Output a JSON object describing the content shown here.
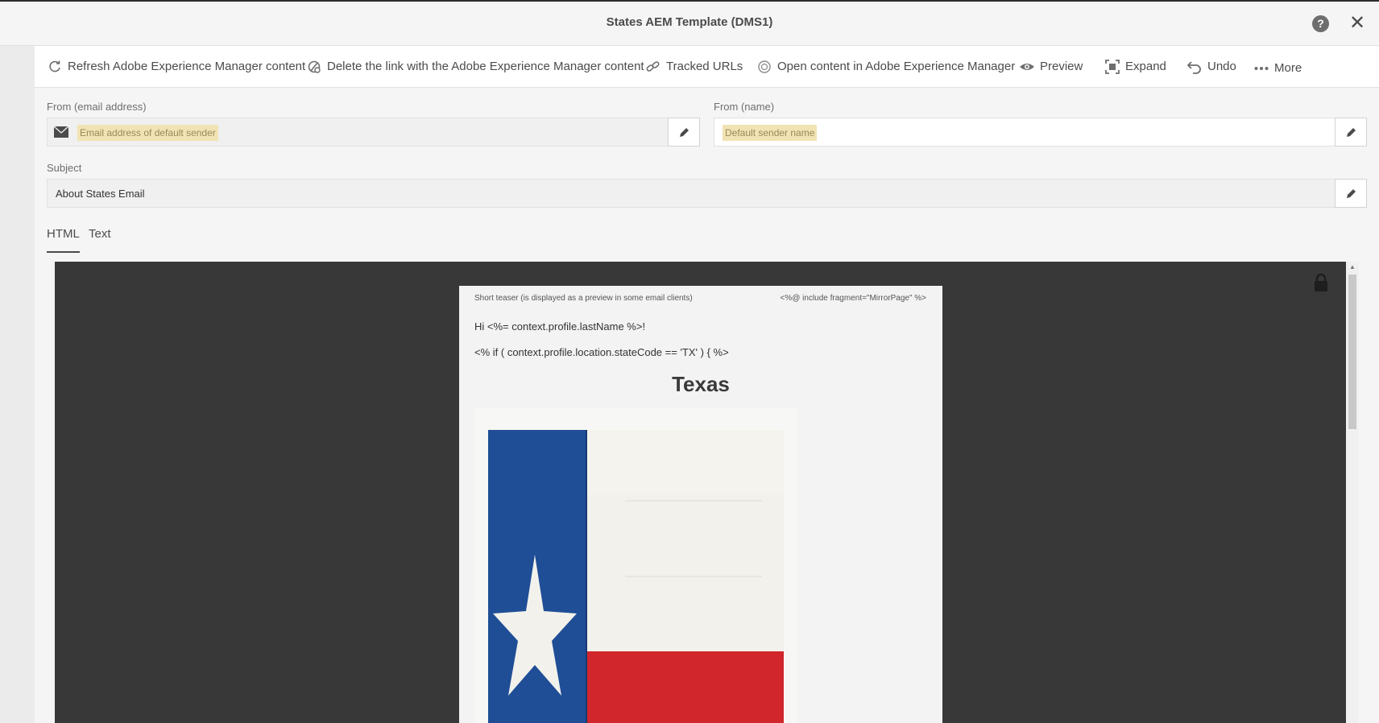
{
  "window": {
    "title": "States AEM Template (DMS1)",
    "help_icon": "help-icon",
    "close_icon": "close-icon"
  },
  "toolbar": {
    "items": [
      {
        "label": "Refresh Adobe Experience Manager content",
        "icon": "refresh-icon"
      },
      {
        "label": "Delete the link with the Adobe Experience Manager content",
        "icon": "unlink-icon"
      },
      {
        "label": "Tracked URLs",
        "icon": "link-icon"
      },
      {
        "label": "Open content in Adobe Experience Manager",
        "icon": "aem-icon"
      },
      {
        "label": "Preview",
        "icon": "eye-icon"
      },
      {
        "label": "Expand",
        "icon": "expand-icon"
      },
      {
        "label": "Undo",
        "icon": "undo-icon"
      },
      {
        "label": "More",
        "icon": "more-icon"
      }
    ]
  },
  "form": {
    "from_email": {
      "label": "From (email address)",
      "placeholder": "Email address of default sender",
      "icon": "envelope-icon"
    },
    "from_name": {
      "label": "From (name)",
      "placeholder": "Default sender name"
    },
    "subject": {
      "label": "Subject",
      "value": "About States Email"
    }
  },
  "tabs": [
    {
      "label": "HTML",
      "active": true
    },
    {
      "label": "Text",
      "active": false
    }
  ],
  "email_preview": {
    "teaser": "Short teaser (is displayed as a preview in some email clients)",
    "mirror_tag": "<%@ include fragment=\"MirrorPage\" %>",
    "greeting": "Hi <%= context.profile.lastName %>!",
    "condition": "<% if ( context.profile.location.stateCode == 'TX' ) { %>",
    "state_title": "Texas",
    "image": "texas-flag-image"
  },
  "colors": {
    "editor_bg": "#383838",
    "placeholder_highlight": "#f1e3b3",
    "flag_blue": "#1f4e96",
    "flag_red": "#d1262b",
    "flag_white": "#f2f1ec"
  }
}
